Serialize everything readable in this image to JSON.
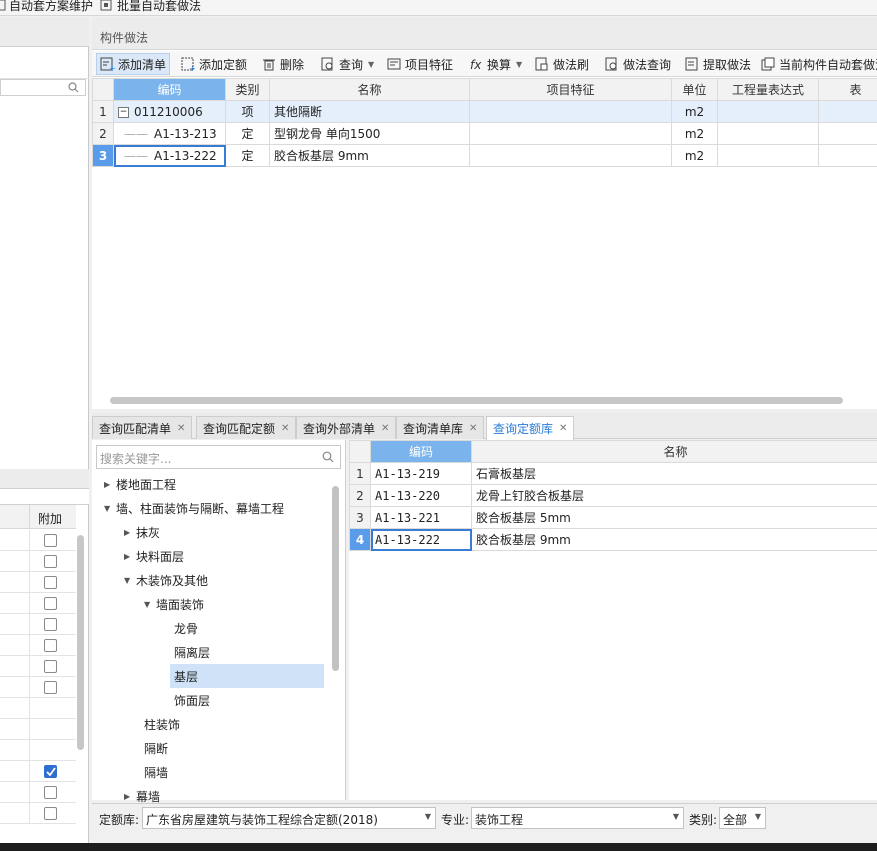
{
  "top_toolbar": {
    "auto_scheme_label": "自动套方案维护",
    "batch_auto_label": "批量自动套做法"
  },
  "left_panel": {
    "col_extra_label": "附加",
    "checkbox_states": [
      false,
      false,
      false,
      false,
      false,
      false,
      false,
      false,
      false,
      false,
      false,
      true,
      false,
      false
    ]
  },
  "main_section": {
    "title": "构件做法",
    "toolbar": [
      {
        "label": "添加清单",
        "icon": "add-list-icon",
        "dropdown": false
      },
      {
        "label": "添加定额",
        "icon": "add-quota-icon",
        "dropdown": false
      },
      {
        "label": "删除",
        "icon": "delete-icon",
        "dropdown": false
      },
      {
        "label": "查询",
        "icon": "query-icon",
        "dropdown": true
      },
      {
        "label": "项目特征",
        "icon": "feature-icon",
        "dropdown": false
      },
      {
        "label": "换算",
        "icon": "fx-icon",
        "dropdown": true
      },
      {
        "label": "做法刷",
        "icon": "brush-icon",
        "dropdown": false
      },
      {
        "label": "做法查询",
        "icon": "method-query-icon",
        "dropdown": false
      },
      {
        "label": "提取做法",
        "icon": "extract-icon",
        "dropdown": false
      },
      {
        "label": "当前构件自动套做法",
        "icon": "auto-apply-icon",
        "dropdown": false
      }
    ],
    "table": {
      "headers": [
        "编码",
        "类别",
        "名称",
        "项目特征",
        "单位",
        "工程量表达式",
        "表"
      ],
      "rows": [
        {
          "num": "1",
          "code": "011210006",
          "type": "项",
          "name": "其他隔断",
          "feature": "",
          "unit": "m2",
          "expr": ""
        },
        {
          "num": "2",
          "code": "A1-13-213",
          "type": "定",
          "name": "型钢龙骨 单向1500",
          "feature": "",
          "unit": "m2",
          "expr": ""
        },
        {
          "num": "3",
          "code": "A1-13-222",
          "type": "定",
          "name": "胶合板基层 9mm",
          "feature": "",
          "unit": "m2",
          "expr": ""
        }
      ]
    }
  },
  "bottom_tabs": [
    {
      "label": "查询匹配清单",
      "active": false
    },
    {
      "label": "查询匹配定额",
      "active": false
    },
    {
      "label": "查询外部清单",
      "active": false
    },
    {
      "label": "查询清单库",
      "active": false
    },
    {
      "label": "查询定额库",
      "active": true
    }
  ],
  "tree": {
    "search_placeholder": "搜索关键字...",
    "nodes": [
      {
        "label": "楼地面工程",
        "level": 0,
        "arrow": "collapsed",
        "selected": false
      },
      {
        "label": "墙、柱面装饰与隔断、幕墙工程",
        "level": 0,
        "arrow": "expanded",
        "selected": false
      },
      {
        "label": "抹灰",
        "level": 1,
        "arrow": "collapsed",
        "selected": false
      },
      {
        "label": "块料面层",
        "level": 1,
        "arrow": "collapsed",
        "selected": false
      },
      {
        "label": "木装饰及其他",
        "level": 1,
        "arrow": "expanded",
        "selected": false
      },
      {
        "label": "墙面装饰",
        "level": 2,
        "arrow": "expanded",
        "selected": false
      },
      {
        "label": "龙骨",
        "level": 3,
        "arrow": "none",
        "selected": false
      },
      {
        "label": "隔离层",
        "level": 3,
        "arrow": "none",
        "selected": false
      },
      {
        "label": "基层",
        "level": 3,
        "arrow": "none",
        "selected": true
      },
      {
        "label": "饰面层",
        "level": 3,
        "arrow": "none",
        "selected": false
      },
      {
        "label": "柱装饰",
        "level": 2,
        "arrow": "none",
        "selected": false
      },
      {
        "label": "隔断",
        "level": 2,
        "arrow": "none",
        "selected": false
      },
      {
        "label": "隔墙",
        "level": 2,
        "arrow": "none",
        "selected": false
      },
      {
        "label": "幕墙",
        "level": 1,
        "arrow": "collapsed",
        "selected": false
      }
    ]
  },
  "quota_table": {
    "headers": [
      "编码",
      "名称"
    ],
    "rows": [
      {
        "num": "1",
        "code": "A1-13-219",
        "name": "石膏板基层"
      },
      {
        "num": "2",
        "code": "A1-13-220",
        "name": "龙骨上钉胶合板基层"
      },
      {
        "num": "3",
        "code": "A1-13-221",
        "name": "胶合板基层 5mm"
      },
      {
        "num": "4",
        "code": "A1-13-222",
        "name": "胶合板基层 9mm"
      }
    ]
  },
  "filter_bar": {
    "library_label": "定额库:",
    "library_value": "广东省房屋建筑与装饰工程综合定额(2018)",
    "major_label": "专业:",
    "major_value": "装饰工程",
    "category_label": "类别:",
    "category_value": "全部"
  },
  "colors": {
    "accent": "#2b7bd6",
    "header_highlight": "#7bb4ec",
    "selection": "#cfe2f8"
  }
}
